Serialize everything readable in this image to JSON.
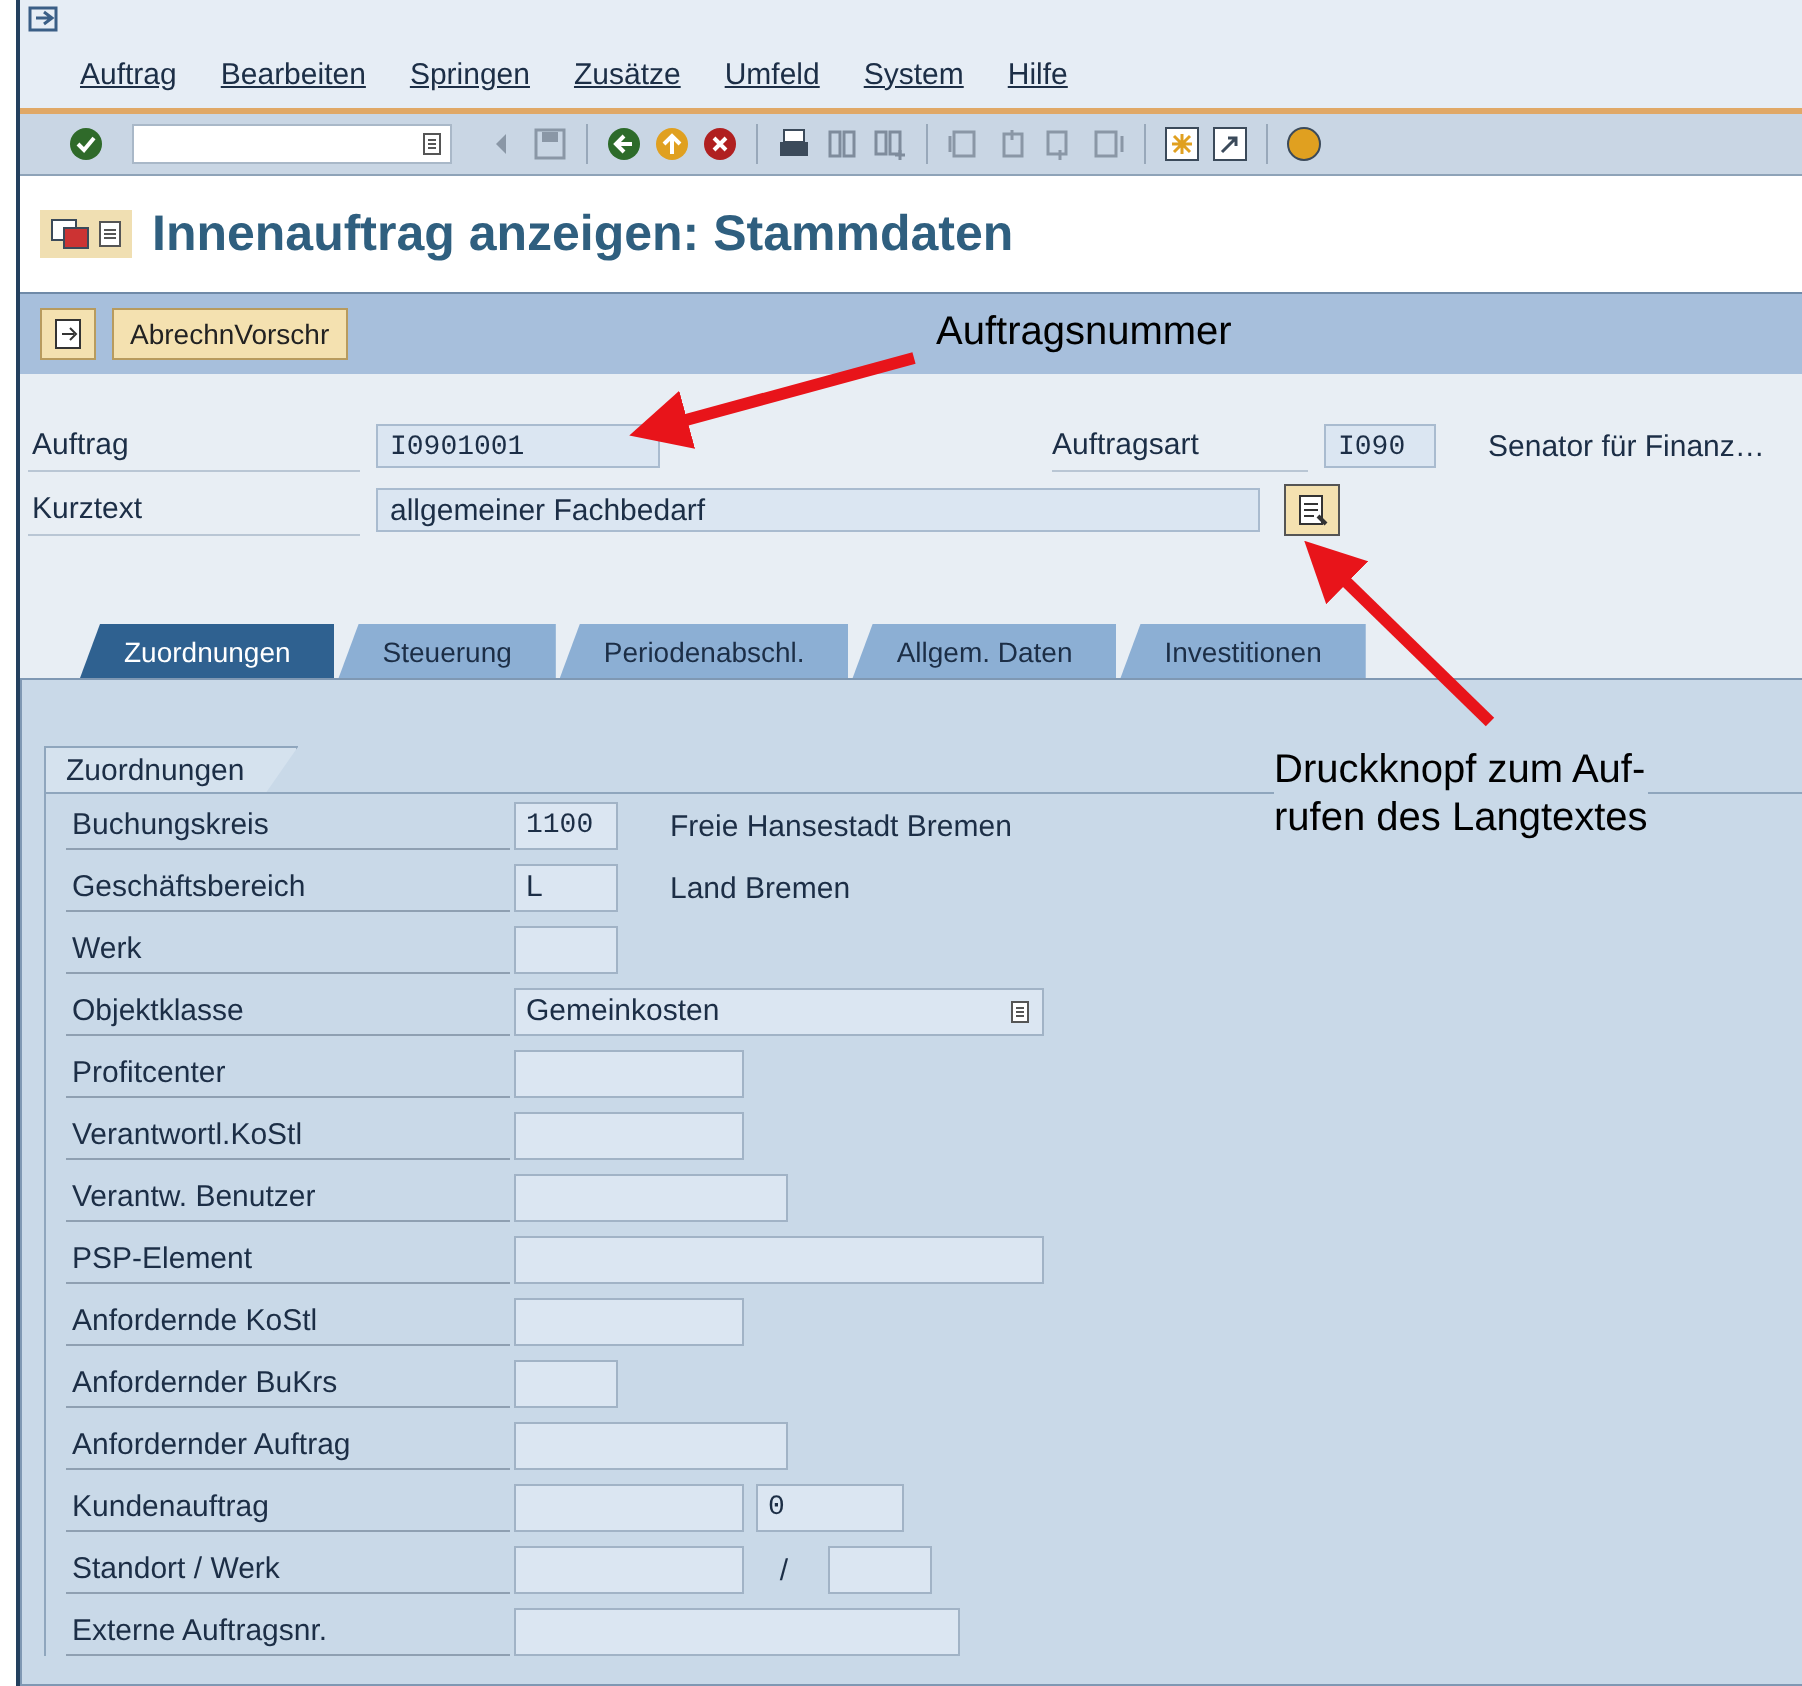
{
  "menu": [
    {
      "label": "Auftrag"
    },
    {
      "label": "Bearbeiten"
    },
    {
      "label": "Springen"
    },
    {
      "label": "Zusätze"
    },
    {
      "label": "Umfeld"
    },
    {
      "label": "System"
    },
    {
      "label": "Hilfe"
    }
  ],
  "title": "Innenauftrag anzeigen: Stammdaten",
  "app_toolbar": {
    "buttons": [
      {
        "label": "AbrechnVorschr"
      }
    ]
  },
  "header": {
    "order": {
      "label": "Auftrag",
      "value": "I0901001"
    },
    "order_type": {
      "label": "Auftragsart",
      "value": "I090",
      "description": "Senator für Finanz…"
    },
    "short_text": {
      "label": "Kurztext",
      "value": "allgemeiner Fachbedarf"
    }
  },
  "tabs": [
    {
      "label": "Zuordnungen",
      "selected": true
    },
    {
      "label": "Steuerung",
      "selected": false
    },
    {
      "label": "Periodenabschl.",
      "selected": false
    },
    {
      "label": "Allgem. Daten",
      "selected": false
    },
    {
      "label": "Investitionen",
      "selected": false
    }
  ],
  "group": {
    "title": "Zuordnungen",
    "rows": [
      {
        "label": "Buchungskreis",
        "fields": [
          {
            "kind": "input",
            "value": "1100"
          }
        ],
        "description": "Freie Hansestadt Bremen"
      },
      {
        "label": "Geschäftsbereich",
        "fields": [
          {
            "kind": "input",
            "value": "L"
          }
        ],
        "description": "Land Bremen"
      },
      {
        "label": "Werk",
        "fields": [
          {
            "kind": "input"
          }
        ]
      },
      {
        "label": "Objektklasse",
        "fields": [
          {
            "kind": "dropdown",
            "value": "Gemeinkosten"
          }
        ]
      },
      {
        "label": "Profitcenter",
        "fields": [
          {
            "kind": "input"
          }
        ]
      },
      {
        "label": "Verantwortl.KoStl",
        "fields": [
          {
            "kind": "input"
          }
        ]
      },
      {
        "label": "Verantw. Benutzer",
        "fields": [
          {
            "kind": "input"
          }
        ]
      },
      {
        "label": "PSP-Element",
        "fields": [
          {
            "kind": "input"
          }
        ]
      },
      {
        "label": "Anfordernde KoStl",
        "fields": [
          {
            "kind": "input"
          }
        ]
      },
      {
        "label": "Anfordernder BuKrs",
        "fields": [
          {
            "kind": "input"
          }
        ]
      },
      {
        "label": "Anfordernder Auftrag",
        "fields": [
          {
            "kind": "input"
          }
        ]
      },
      {
        "label": "Kundenauftrag",
        "fields": [
          {
            "kind": "input"
          },
          {
            "kind": "input",
            "value": "0"
          }
        ]
      },
      {
        "label": "Standort / Werk",
        "fields": [
          {
            "kind": "input"
          },
          {
            "kind": "separator",
            "text": "/"
          },
          {
            "kind": "input"
          }
        ]
      },
      {
        "label": "Externe Auftragsnr.",
        "fields": [
          {
            "kind": "input"
          }
        ]
      }
    ]
  },
  "annotations": [
    {
      "text": "Auftragsnummer"
    },
    {
      "text": "Druckknopf zum Auf-\nrufen des Langtextes"
    }
  ]
}
